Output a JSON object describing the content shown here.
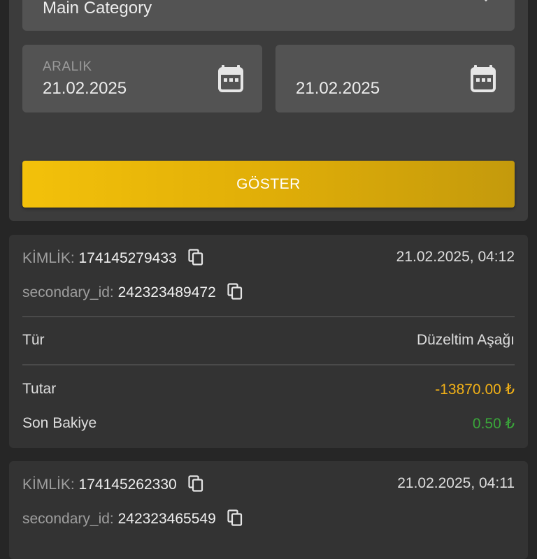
{
  "filters": {
    "category_value": "Main Category",
    "date_start_label": "ARALIK",
    "date_start_value": "21.02.2025",
    "date_end_value": "21.02.2025",
    "show_button_label": "GÖSTER"
  },
  "transactions": [
    {
      "id_label": "KİMLİK:",
      "id_value": "174145279433",
      "datetime": "21.02.2025, 04:12",
      "secondary_label": "secondary_id:",
      "secondary_value": "242323489472",
      "type_label": "Tür",
      "type_value": "Düzeltim Aşağı",
      "amount_label": "Tutar",
      "amount_value": "-13870.00 ₺",
      "balance_label": "Son Bakiye",
      "balance_value": "0.50 ₺"
    },
    {
      "id_label": "KİMLİK:",
      "id_value": "174145262330",
      "datetime": "21.02.2025, 04:11",
      "secondary_label": "secondary_id:",
      "secondary_value": "242323465549"
    }
  ],
  "colors": {
    "accent": "#f3c10a",
    "negative_amount": "#f2b117",
    "positive_amount": "#3aa63a",
    "card_bg": "#333333",
    "page_bg": "#262626"
  },
  "icons": {
    "calendar": "calendar-icon",
    "copy": "copy-icon",
    "dropdown": "chevron-down-icon"
  }
}
